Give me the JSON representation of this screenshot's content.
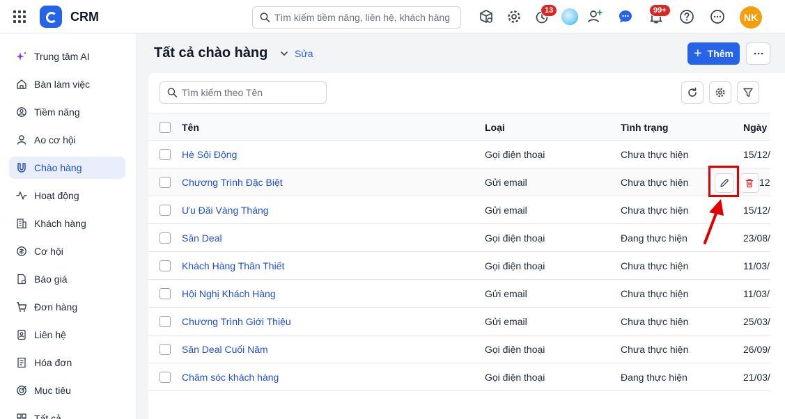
{
  "app": {
    "name": "CRM"
  },
  "topbar": {
    "search_placeholder": "Tìm kiếm tiềm năng, liên hệ, khách hàng",
    "reminder_count": "13",
    "notification_count": "99+",
    "user_initials": "NK",
    "avatar_color": "#f59e0b"
  },
  "sidebar": {
    "items": [
      {
        "label": "Trung tâm AI",
        "icon": "sparkle-icon"
      },
      {
        "label": "Bàn làm việc",
        "icon": "home-icon"
      },
      {
        "label": "Tiềm năng",
        "icon": "prospect-icon"
      },
      {
        "label": "Ao cơ hội",
        "icon": "pool-icon"
      },
      {
        "label": "Chào hàng",
        "icon": "magnet-icon",
        "active": true
      },
      {
        "label": "Hoạt động",
        "icon": "activity-icon"
      },
      {
        "label": "Khách hàng",
        "icon": "building-icon"
      },
      {
        "label": "Cơ hội",
        "icon": "opportunity-icon"
      },
      {
        "label": "Báo giá",
        "icon": "quote-icon"
      },
      {
        "label": "Đơn hàng",
        "icon": "cart-icon"
      },
      {
        "label": "Liên hệ",
        "icon": "contact-icon"
      },
      {
        "label": "Hóa đơn",
        "icon": "invoice-icon"
      },
      {
        "label": "Mục tiêu",
        "icon": "target-icon"
      },
      {
        "label": "Tất cả",
        "icon": "all-icon"
      }
    ]
  },
  "page": {
    "title": "Tất cả chào hàng",
    "edit_label": "Sửa",
    "add_label": "Thêm"
  },
  "list": {
    "search_placeholder": "Tìm kiếm theo Tên",
    "columns": {
      "name": "Tên",
      "type": "Loại",
      "status": "Tình trạng",
      "date": "Ngày l"
    },
    "rows": [
      {
        "name": "Hè Sôi Động",
        "type": "Gọi điện thoại",
        "status": "Chưa thực hiện",
        "date": "15/12/"
      },
      {
        "name": "Chương Trình Đặc Biệt",
        "type": "Gửi email",
        "status": "Chưa thực hiện",
        "date": "12/"
      },
      {
        "name": "Ưu Đãi Vàng Tháng",
        "type": "Gửi email",
        "status": "Chưa thực hiện",
        "date": "15/12/"
      },
      {
        "name": "Săn Deal",
        "type": "Gọi điện thoại",
        "status": "Đang thực hiện",
        "date": "23/08/"
      },
      {
        "name": "Khách Hàng Thân Thiết",
        "type": "Gọi điện thoại",
        "status": "Chưa thực hiện",
        "date": "11/03/"
      },
      {
        "name": "Hội Nghị Khách Hàng",
        "type": "Gửi email",
        "status": "Chưa thực hiện",
        "date": "11/03/"
      },
      {
        "name": "Chương Trình Giới Thiệu",
        "type": "Gửi email",
        "status": "Chưa thực hiện",
        "date": "25/03/"
      },
      {
        "name": "Săn Deal Cuối Năm",
        "type": "Gọi điện thoại",
        "status": "Chưa thực hiện",
        "date": "26/09/"
      },
      {
        "name": "Chăm sóc khách hàng",
        "type": "Gọi điện thoại",
        "status": "Đang thực hiện",
        "date": "21/03/"
      }
    ]
  },
  "colors": {
    "accent": "#2563eb",
    "link": "#1d4ed8",
    "annotation": "#e00000",
    "delete": "#dc2626"
  }
}
